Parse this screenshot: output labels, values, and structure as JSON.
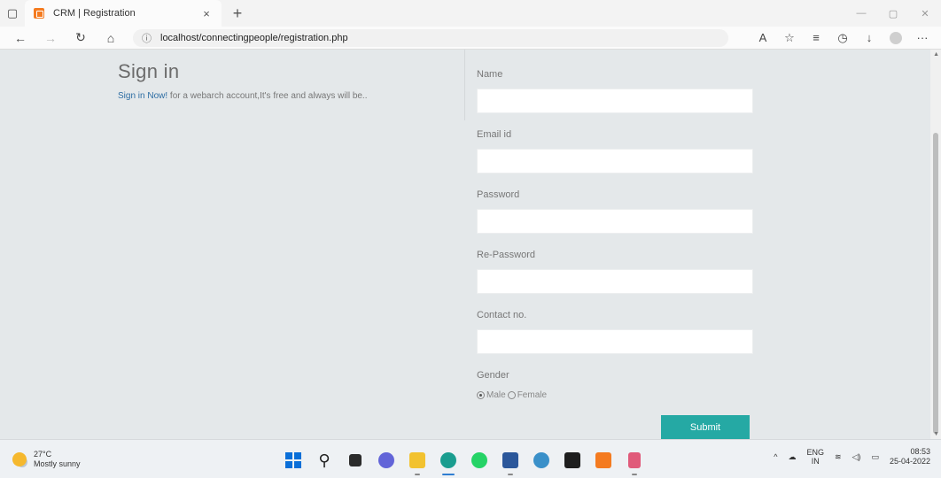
{
  "browser": {
    "tab_title": "CRM | Registration",
    "tab_close": "×",
    "new_tab": "+",
    "url": "localhost/connectingpeople/registration.php",
    "buttons": [
      "back-icon",
      "forward-icon",
      "refresh-icon",
      "home-icon"
    ]
  },
  "signin": {
    "title": "Sign in",
    "link_text": "Sign in Now!",
    "subtitle_rest": " for a webarch account,It's free and always will be.."
  },
  "form": {
    "fields": [
      {
        "label": "Name",
        "value": ""
      },
      {
        "label": "Email id",
        "value": ""
      },
      {
        "label": "Password",
        "value": ""
      },
      {
        "label": "Re-Password",
        "value": ""
      },
      {
        "label": "Contact no.",
        "value": ""
      }
    ],
    "gender_label": "Gender",
    "gender_options": [
      "Male",
      "Female"
    ],
    "gender_selected": "Male",
    "submit_label": "Submit",
    "accent_color": "#25a9a4"
  },
  "taskbar": {
    "temperature": "27°C",
    "weather": "Mostly sunny",
    "lang_top": "ENG",
    "lang_bottom": "IN",
    "time": "08:53",
    "date": "25-04-2022"
  }
}
